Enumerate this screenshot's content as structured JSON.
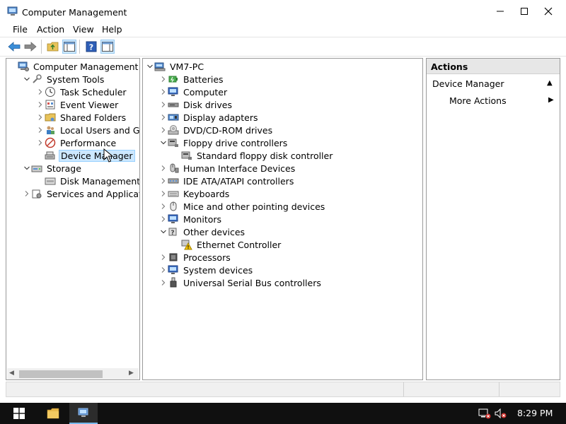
{
  "window": {
    "title": "Computer Management"
  },
  "menu": [
    "File",
    "Action",
    "View",
    "Help"
  ],
  "left_tree": [
    {
      "label": "Computer Management (Local",
      "level": 0,
      "expander": "none",
      "icon": "computer-management-icon"
    },
    {
      "label": "System Tools",
      "level": 1,
      "expander": "expanded",
      "icon": "tools-icon"
    },
    {
      "label": "Task Scheduler",
      "level": 2,
      "expander": "collapsed",
      "icon": "clock-icon"
    },
    {
      "label": "Event Viewer",
      "level": 2,
      "expander": "collapsed",
      "icon": "event-viewer-icon"
    },
    {
      "label": "Shared Folders",
      "level": 2,
      "expander": "collapsed",
      "icon": "shared-folders-icon"
    },
    {
      "label": "Local Users and Groups",
      "level": 2,
      "expander": "collapsed",
      "icon": "users-icon"
    },
    {
      "label": "Performance",
      "level": 2,
      "expander": "collapsed",
      "icon": "performance-icon"
    },
    {
      "label": "Device Manager",
      "level": 2,
      "expander": "none",
      "icon": "device-manager-icon",
      "selected": true
    },
    {
      "label": "Storage",
      "level": 1,
      "expander": "expanded",
      "icon": "storage-icon"
    },
    {
      "label": "Disk Management",
      "level": 2,
      "expander": "none",
      "icon": "disk-management-icon"
    },
    {
      "label": "Services and Applications",
      "level": 1,
      "expander": "collapsed",
      "icon": "services-icon"
    }
  ],
  "device_tree": [
    {
      "label": "VM7-PC",
      "level": 0,
      "expander": "expanded",
      "icon": "computer-icon"
    },
    {
      "label": "Batteries",
      "level": 1,
      "expander": "collapsed",
      "icon": "battery-icon"
    },
    {
      "label": "Computer",
      "level": 1,
      "expander": "collapsed",
      "icon": "monitor-icon"
    },
    {
      "label": "Disk drives",
      "level": 1,
      "expander": "collapsed",
      "icon": "disk-drive-icon"
    },
    {
      "label": "Display adapters",
      "level": 1,
      "expander": "collapsed",
      "icon": "display-adapter-icon"
    },
    {
      "label": "DVD/CD-ROM drives",
      "level": 1,
      "expander": "collapsed",
      "icon": "dvd-icon"
    },
    {
      "label": "Floppy drive controllers",
      "level": 1,
      "expander": "expanded",
      "icon": "controller-icon"
    },
    {
      "label": "Standard floppy disk controller",
      "level": 2,
      "expander": "none",
      "icon": "controller-icon"
    },
    {
      "label": "Human Interface Devices",
      "level": 1,
      "expander": "collapsed",
      "icon": "hid-icon"
    },
    {
      "label": "IDE ATA/ATAPI controllers",
      "level": 1,
      "expander": "collapsed",
      "icon": "ide-icon"
    },
    {
      "label": "Keyboards",
      "level": 1,
      "expander": "collapsed",
      "icon": "keyboard-icon"
    },
    {
      "label": "Mice and other pointing devices",
      "level": 1,
      "expander": "collapsed",
      "icon": "mouse-icon"
    },
    {
      "label": "Monitors",
      "level": 1,
      "expander": "collapsed",
      "icon": "monitor-icon"
    },
    {
      "label": "Other devices",
      "level": 1,
      "expander": "expanded",
      "icon": "unknown-device-icon"
    },
    {
      "label": "Ethernet Controller",
      "level": 2,
      "expander": "none",
      "icon": "warning-device-icon"
    },
    {
      "label": "Processors",
      "level": 1,
      "expander": "collapsed",
      "icon": "processor-icon"
    },
    {
      "label": "System devices",
      "level": 1,
      "expander": "collapsed",
      "icon": "monitor-icon"
    },
    {
      "label": "Universal Serial Bus controllers",
      "level": 1,
      "expander": "collapsed",
      "icon": "usb-icon"
    }
  ],
  "actions": {
    "title": "Actions",
    "section": "Device Manager",
    "more": "More Actions"
  },
  "taskbar": {
    "time": "8:29 PM"
  }
}
